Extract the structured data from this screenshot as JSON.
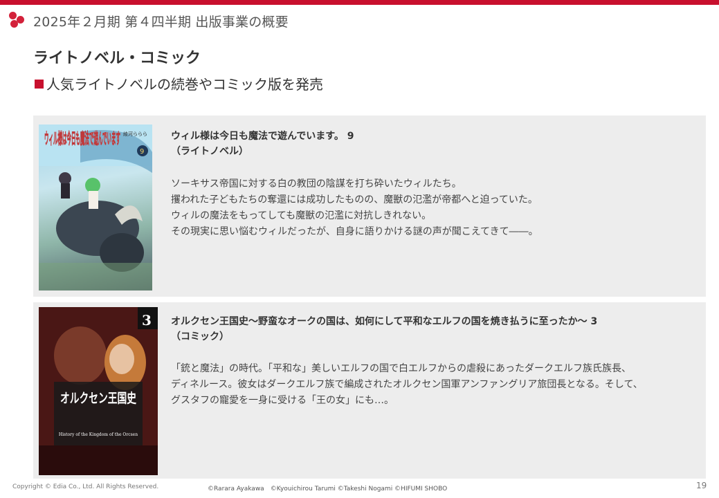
{
  "header": {
    "title": "2025年２月期 第４四半期 出版事業の概要"
  },
  "section": {
    "title": "ライトノベル・コミック",
    "subtitle": "人気ライトノベルの続巻やコミック版を発売"
  },
  "books": [
    {
      "title_line1": "ウィル様は今日も魔法で遊んでいます。 9",
      "title_line2": "（ライトノベル）",
      "description": [
        "ソーキサス帝国に対する白の教団の陰謀を打ち砕いたウィルたち。",
        "攫われた子どもたちの奪還には成功したものの、魔獣の氾濫が帝都へと迫っていた。",
        "ウィルの魔法をもってしても魔獣の氾濫に対抗しきれない。",
        "その現実に思い悩むウィルだったが、自身に語りかける謎の声が聞こえてきて――。"
      ],
      "cover": {
        "title_text": "ウィル様は今日も魔法で遊んでいます",
        "author_text": "綾河ららら",
        "volume": "9"
      }
    },
    {
      "title_line1": "オルクセン王国史～野蛮なオークの国は、如何にして平和なエルフの国を焼き払うに至ったか～ 3",
      "title_line2": "（コミック）",
      "description": [
        "「銃と魔法」の時代。「平和な」美しいエルフの国で白エルフからの虐殺にあったダークエルフ族氏族長、",
        "ディネルース。彼女はダークエルフ族で編成されたオルクセン国軍アンファングリア旅団長となる。そして、",
        "グスタフの寵愛を一身に受ける「王の女」にも…。"
      ],
      "cover": {
        "title_text": "オルクセン王国史",
        "subtitle_text": "History of the Kingdom of the Orcsen",
        "volume": "3"
      }
    }
  ],
  "footer": {
    "copyright": "Copyright © Edia Co., Ltd. All Rights Reserved.",
    "credits": "©Rarara Ayakawa　©Kyouichirou Tarumi ©Takeshi Nogami ©HIFUMI SHOBO",
    "page_number": "19"
  },
  "colors": {
    "accent": "#c8102e",
    "card_bg": "#ededed"
  }
}
